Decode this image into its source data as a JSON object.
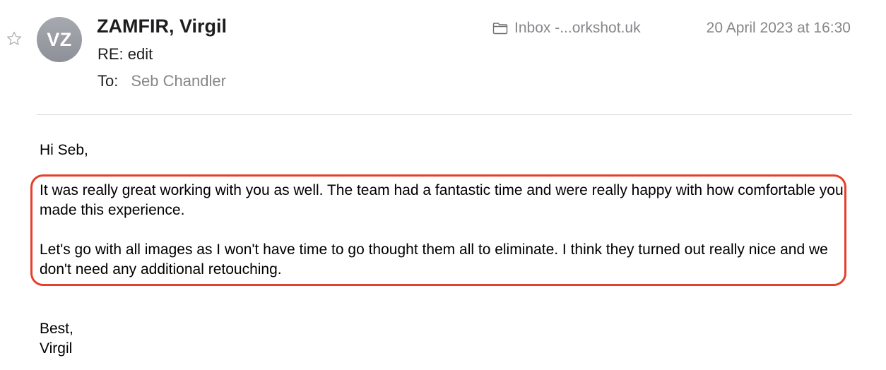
{
  "header": {
    "avatar_initials": "VZ",
    "sender": "ZAMFIR, Virgil",
    "subject": "RE: edit",
    "to_label": "To:",
    "to_name": "Seb Chandler",
    "mailbox": "Inbox -...orkshot.uk",
    "date": "20 April 2023 at 16:30",
    "star_icon": "star-outline-icon",
    "folder_icon": "folder-icon"
  },
  "body": {
    "greeting": "Hi Seb,",
    "paragraph1": "It was really great working with you as well. The team had a fantastic time and were really happy with how comfortable you made this experience.",
    "paragraph2": "Let's go with all images as I won't have time to go thought them all to eliminate. I think they turned out really nice and we don't need any additional retouching.",
    "signoff": "Best,",
    "signature": "Virgil"
  },
  "colors": {
    "highlight_border": "#e5402c",
    "secondary_text": "#86868b",
    "avatar_bg": "#9a9ca3"
  }
}
